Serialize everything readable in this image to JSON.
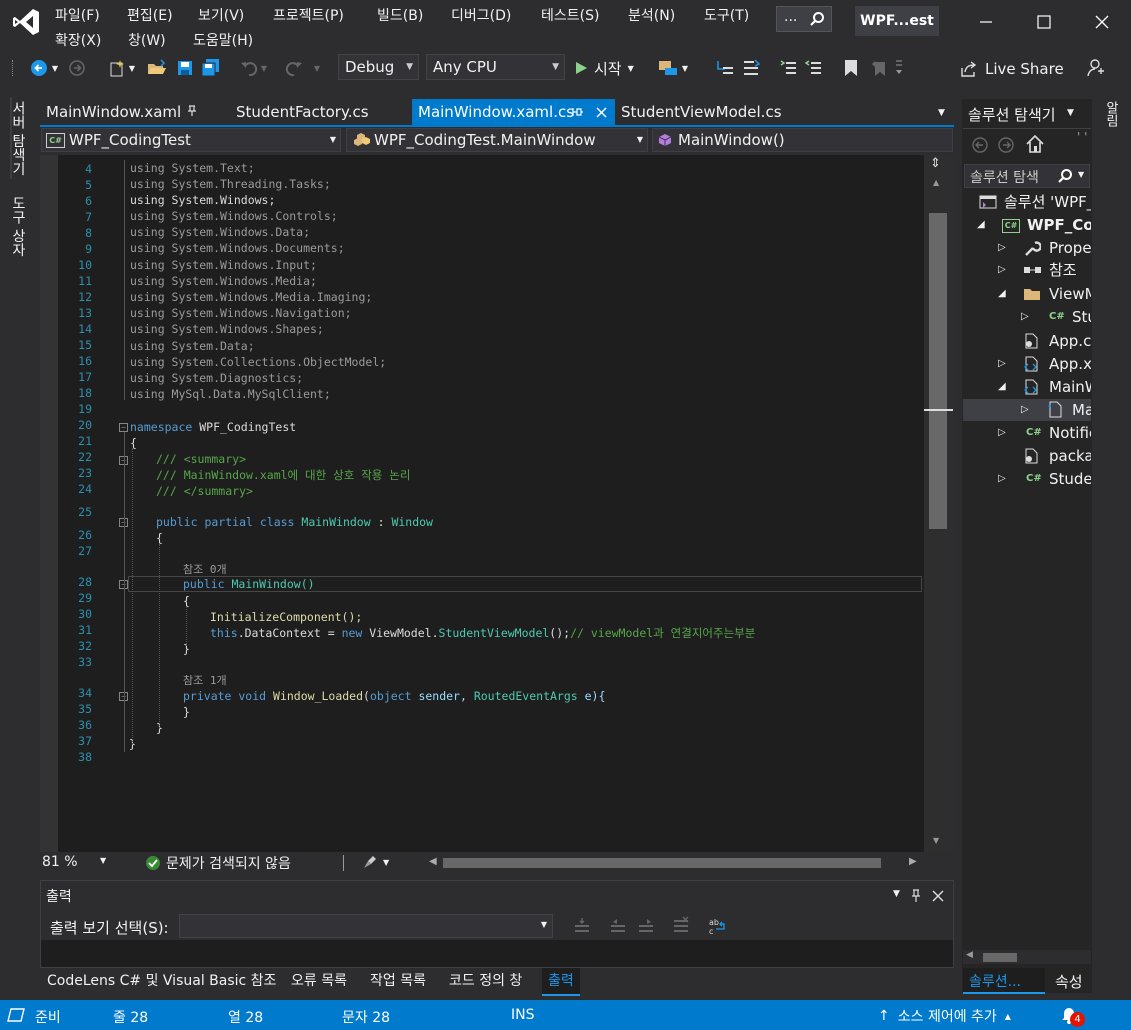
{
  "menu": {
    "file": "파일(F)",
    "edit": "편집(E)",
    "view": "보기(V)",
    "project": "프로젝트(P)",
    "build": "빌드(B)",
    "debug": "디버그(D)",
    "test": "테스트(S)",
    "analyze": "분석(N)",
    "tools": "도구(T)",
    "extensions": "확장(X)",
    "window": "창(W)",
    "help": "도움말(H)"
  },
  "search": {
    "label": "..."
  },
  "project_badge": "WPF...est",
  "toolbar": {
    "config": "Debug",
    "platform": "Any CPU",
    "start_label": "시작",
    "live_share": "Live Share"
  },
  "left_tabs": {
    "server_explorer": "서버 탐색기",
    "toolbox": "도구 상자"
  },
  "doc_tabs": [
    {
      "label": "MainWindow.xaml"
    },
    {
      "label": "StudentFactory.cs"
    },
    {
      "label": "MainWindow.xaml.cs"
    },
    {
      "label": "StudentViewModel.cs"
    }
  ],
  "navbar": {
    "project": "WPF_CodingTest",
    "class": "WPF_CodingTest.MainWindow",
    "member": "MainWindow()"
  },
  "code": {
    "l4": "using System.Text;",
    "l5": "using System.Threading.Tasks;",
    "l6": "using System.Windows;",
    "l7": "using System.Windows.Controls;",
    "l8": "using System.Windows.Data;",
    "l9": "using System.Windows.Documents;",
    "l10": "using System.Windows.Input;",
    "l11": "using System.Windows.Media;",
    "l12": "using System.Windows.Media.Imaging;",
    "l13": "using System.Windows.Navigation;",
    "l14": "using System.Windows.Shapes;",
    "l15": "using System.Data;",
    "l16": "using System.Collections.ObjectModel;",
    "l17": "using System.Diagnostics;",
    "l18": "using MySql.Data.MySqlClient;",
    "l20_kw": "namespace",
    "l20_name": " WPF_CodingTest",
    "l21": "{",
    "l22": "/// <summary>",
    "l23": "/// MainWindow.xaml에 대한 상호 작용 논리",
    "l24": "/// </summary>",
    "l25_kw": "public partial class",
    "l25_name": " MainWindow",
    "l25_sep": " : ",
    "l25_base": "Window",
    "l26": "{",
    "ref0": "참조 0개",
    "l28_kw": "public",
    "l28_name": " MainWindow()",
    "l29": "{",
    "l30": "InitializeComponent();",
    "l31_kw": "this",
    "l31_a": ".DataContext = ",
    "l31_new": "new",
    "l31_ns": " ViewModel.",
    "l31_ty": "StudentViewModel",
    "l31_b": "();",
    "l31_cm": "// viewModel과 연결지어주는부분",
    "l32": "}",
    "ref1": "참조 1개",
    "l34_kw": "private void",
    "l34_fn": " Window_Loaded",
    "l34_p1": "(",
    "l34_obj": "object",
    "l34_sender": " sender, ",
    "l34_rea": "RoutedEventArgs",
    "l34_e": " e){",
    "l35": "}",
    "l36": "}",
    "l37": "}"
  },
  "line_numbers": [
    "4",
    "5",
    "6",
    "7",
    "8",
    "9",
    "10",
    "11",
    "12",
    "13",
    "14",
    "15",
    "16",
    "17",
    "18",
    "19",
    "20",
    "21",
    "22",
    "23",
    "24",
    "25",
    "26",
    "27",
    "28",
    "29",
    "30",
    "31",
    "32",
    "33",
    "34",
    "35",
    "36",
    "37",
    "38"
  ],
  "editor_status": {
    "zoom": "81 %",
    "issues": "문제가 검색되지 않음"
  },
  "output": {
    "title": "출력",
    "show_from_label": "출력 보기 선택(S):",
    "show_from_value": ""
  },
  "bottom_tabs": [
    "CodeLens C# 및 Visual Basic 참조",
    "오류 목록",
    "작업 목록",
    "코드 정의 창",
    "출력"
  ],
  "solution_explorer": {
    "title": "솔루션 탐색기",
    "search_placeholder": "솔루션 탐색",
    "items": [
      "솔루션 'WPF_",
      "WPF_Cod",
      "Prope",
      "참조",
      "ViewM",
      "Stu",
      "App.co",
      "App.xa",
      "MainW",
      "Ma",
      "Notifie",
      "packa",
      "Studer"
    ],
    "tab_solution": "솔루션...",
    "tab_properties": "속성",
    "right_tab": "알림"
  },
  "statusbar": {
    "ready": "준비",
    "line": "줄 28",
    "col": "열 28",
    "char": "문자 28",
    "mode": "INS",
    "source_control": "소스 제어에 추가",
    "notifications": "4"
  },
  "colors": {
    "accent": "#007acc",
    "editor_bg": "#1e1e1e",
    "chrome_bg": "#2d2d30"
  }
}
